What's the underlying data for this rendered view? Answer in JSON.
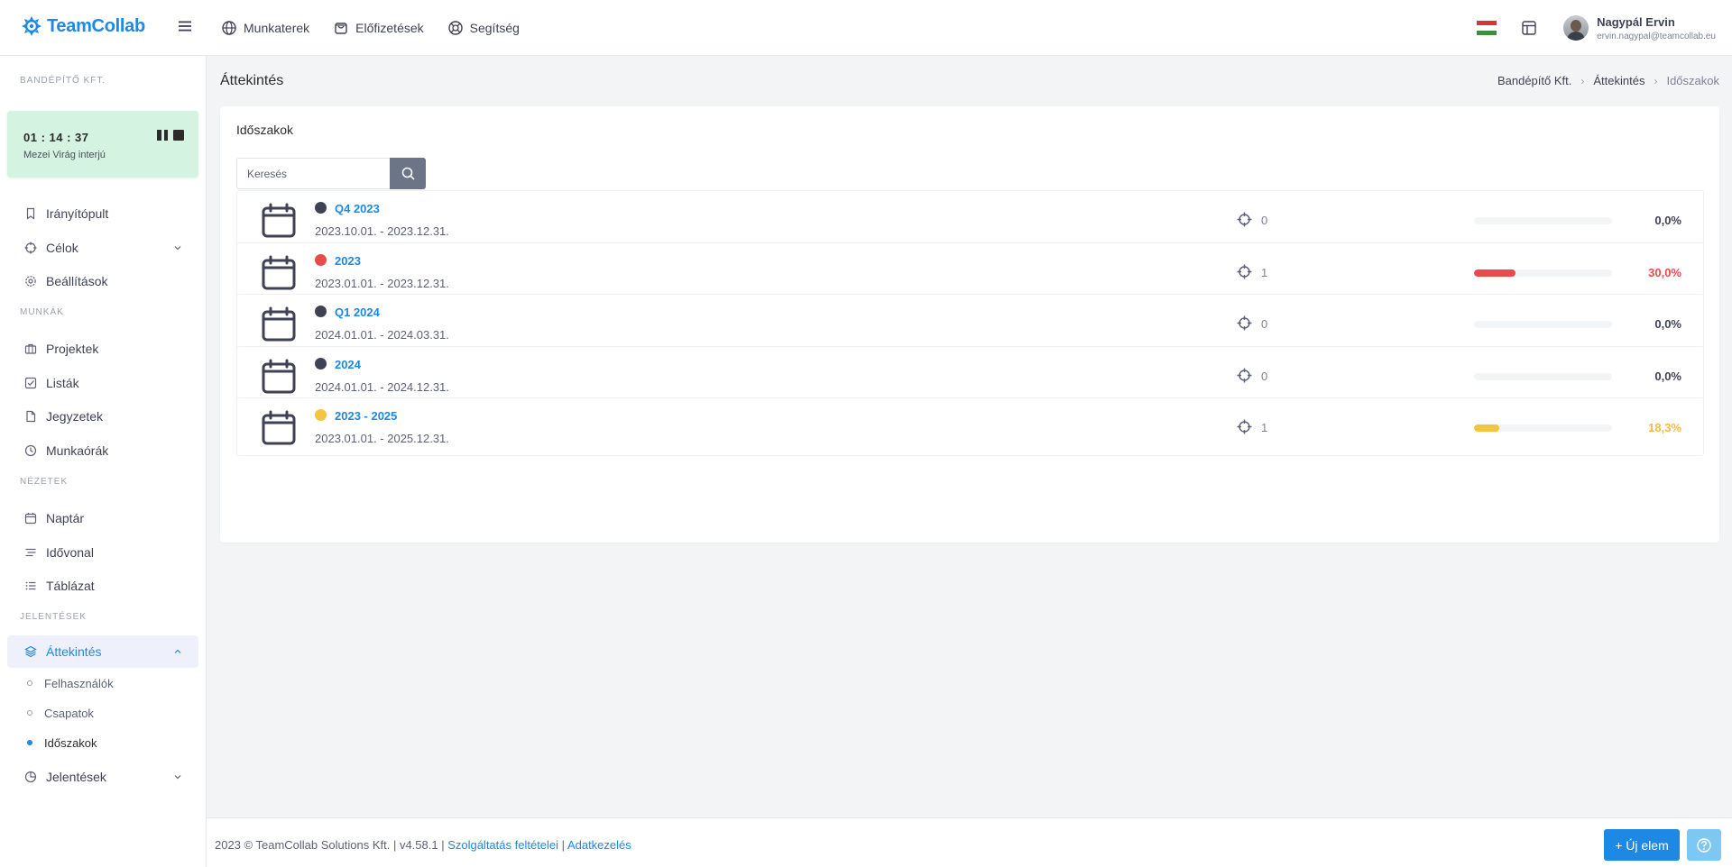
{
  "app": {
    "name": "TeamCollab"
  },
  "topnav": [
    {
      "label": "Munkaterek",
      "icon": "globe-icon"
    },
    {
      "label": "Előfizetések",
      "icon": "bag-icon"
    },
    {
      "label": "Segítség",
      "icon": "lifebuoy-icon"
    }
  ],
  "user": {
    "name": "Nagypál Ervin",
    "email": "ervin.nagypal@teamcollab.eu"
  },
  "sidebar": {
    "company": "BANDÉPÍTŐ KFT.",
    "timer": {
      "time": "01 : 14 : 37",
      "label": "Mezei Virág interjú"
    },
    "items": {
      "dashboard": "Irányítópult",
      "goals": "Célok",
      "settings": "Beállítások",
      "section_works": "MUNKÁK",
      "projects": "Projektek",
      "lists": "Listák",
      "notes": "Jegyzetek",
      "hours": "Munkaórák",
      "section_views": "NÉZETEK",
      "calendar": "Naptár",
      "timeline": "Idővonal",
      "table": "Táblázat",
      "section_reports": "JELENTÉSEK",
      "overview": "Áttekintés",
      "users": "Felhasználók",
      "teams": "Csapatok",
      "periods": "Időszakok",
      "reports": "Jelentések"
    }
  },
  "page": {
    "title": "Áttekintés",
    "breadcrumb": [
      "Bandépítő Kft.",
      "Áttekintés",
      "Időszakok"
    ],
    "card_title": "Időszakok",
    "search_placeholder": "Keresés"
  },
  "periods": [
    {
      "name": "Q4 2023",
      "dates": "2023.10.01. - 2023.12.31.",
      "targets": "0",
      "progress": 0,
      "percent": "0,0%",
      "color": "#3f4254",
      "pct_color": "#3f4254"
    },
    {
      "name": "2023",
      "dates": "2023.01.01. - 2023.12.31.",
      "targets": "1",
      "progress": 0.3,
      "percent": "30,0%",
      "color": "#e94b4b",
      "pct_color": "#e94b4b"
    },
    {
      "name": "Q1 2024",
      "dates": "2024.01.01. - 2024.03.31.",
      "targets": "0",
      "progress": 0,
      "percent": "0,0%",
      "color": "#3f4254",
      "pct_color": "#3f4254"
    },
    {
      "name": "2024",
      "dates": "2024.01.01. - 2024.12.31.",
      "targets": "0",
      "progress": 0,
      "percent": "0,0%",
      "color": "#3f4254",
      "pct_color": "#3f4254"
    },
    {
      "name": "2023 - 2025",
      "dates": "2023.01.01. - 2025.12.31.",
      "targets": "1",
      "progress": 0.183,
      "percent": "18,3%",
      "color": "#f5c542",
      "pct_color": "#f5b942"
    }
  ],
  "footer": {
    "copyright": "2023 © TeamCollab Solutions Kft. | v4.58.1 | ",
    "terms": "Szolgáltatás feltételei",
    "sep": " | ",
    "privacy": "Adatkezelés",
    "new_button": "+ Új elem"
  },
  "colors": {
    "accent": "#1e88e5",
    "timer_bg": "#d4f3e1",
    "active_bg": "#eef1fb"
  }
}
